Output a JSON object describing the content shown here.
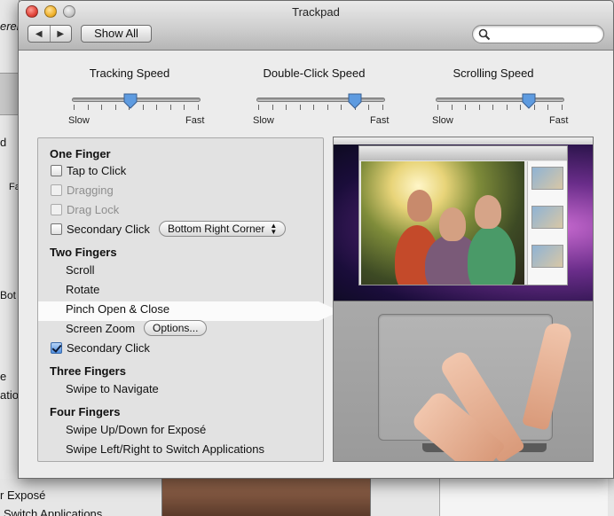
{
  "background_window": {
    "fragments": [
      "erent",
      "d",
      "Fa",
      "Bot",
      "e",
      "ations",
      "r Exposé",
      "Switch Applications"
    ]
  },
  "window": {
    "title": "Trackpad",
    "toolbar": {
      "back_icon": "left-arrow-icon",
      "forward_icon": "right-arrow-icon",
      "show_all_label": "Show All",
      "search_placeholder": "",
      "search_value": ""
    }
  },
  "sliders": [
    {
      "title": "Tracking Speed",
      "min_label": "Slow",
      "max_label": "Fast",
      "value_fraction": 0.45
    },
    {
      "title": "Double-Click Speed",
      "min_label": "Slow",
      "max_label": "Fast",
      "value_fraction": 0.8
    },
    {
      "title": "Scrolling Speed",
      "min_label": "Slow",
      "max_label": "Fast",
      "value_fraction": 0.75
    }
  ],
  "gestures": {
    "one_finger": {
      "header": "One Finger",
      "tap_to_click": "Tap to Click",
      "dragging": "Dragging",
      "drag_lock": "Drag Lock",
      "secondary_click": "Secondary Click",
      "secondary_click_option": "Bottom Right Corner"
    },
    "two_fingers": {
      "header": "Two Fingers",
      "scroll": "Scroll",
      "rotate": "Rotate",
      "pinch": "Pinch Open & Close",
      "screen_zoom": "Screen Zoom",
      "options_label": "Options...",
      "secondary_click": "Secondary Click"
    },
    "three_fingers": {
      "header": "Three Fingers",
      "swipe": "Swipe to Navigate"
    },
    "four_fingers": {
      "header": "Four Fingers",
      "swipe_updown": "Swipe Up/Down for Exposé",
      "swipe_leftright": "Swipe Left/Right to Switch Applications"
    }
  },
  "checkbox_states": {
    "tap_to_click": false,
    "dragging": false,
    "drag_lock": false,
    "one_finger_secondary_click": false,
    "two_finger_secondary_click": true
  },
  "selected_item": "Pinch Open & Close",
  "colors": {
    "selection_highlight": "#fbfbfb",
    "checkbox_checked": "#4f8ee0",
    "close_button": "#e0443a",
    "minimize_button": "#f0b22d"
  }
}
